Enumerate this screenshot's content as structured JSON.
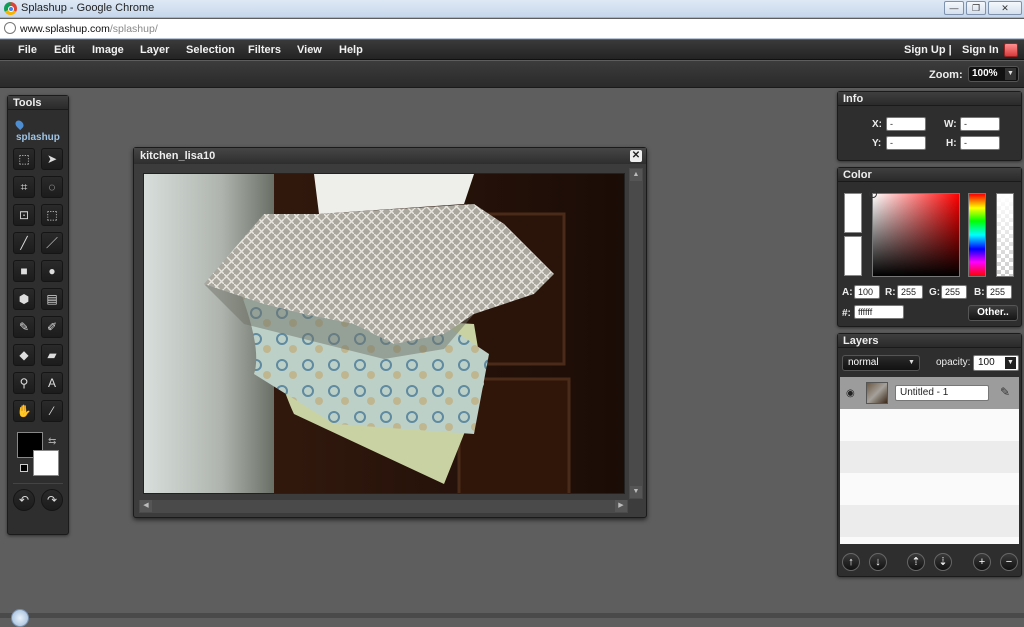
{
  "browser": {
    "window_title": "Splashup - Google Chrome",
    "url_host": "www.splashup.com",
    "url_path": "/splashup/",
    "min_label": "—",
    "max_label": "❐",
    "close_label": "✕"
  },
  "menu": {
    "items": [
      "File",
      "Edit",
      "Image",
      "Layer",
      "Selection",
      "Filters",
      "View",
      "Help"
    ],
    "sign_up": "Sign Up |",
    "sign_in": "Sign In"
  },
  "toolbar": {
    "zoom_label": "Zoom:",
    "zoom_value": "100%"
  },
  "tools_panel": {
    "title": "Tools",
    "logo_text": "splashup",
    "tool_icons": [
      "marquee-rect-icon",
      "move-arrow-icon",
      "crop-icon",
      "lasso-icon",
      "transform-icon",
      "magic-select-icon",
      "pencil-icon",
      "line-icon",
      "rectangle-icon",
      "ellipse-icon",
      "polygon-icon",
      "gradient-icon",
      "brush-icon",
      "airbrush-icon",
      "fill-bucket-icon",
      "eraser-icon",
      "clone-stamp-icon",
      "text-icon",
      "hand-icon",
      "eyedropper-icon"
    ],
    "foreground_color": "#000000",
    "background_color": "#ffffff"
  },
  "document": {
    "title": "kitchen_lisa10",
    "close_label": "✕"
  },
  "info_panel": {
    "title": "Info",
    "x_label": "X:",
    "y_label": "Y:",
    "w_label": "W:",
    "h_label": "H:",
    "x_value": "-",
    "y_value": "-",
    "w_value": "-",
    "h_value": "-"
  },
  "color_panel": {
    "title": "Color",
    "a_label": "A:",
    "r_label": "R:",
    "g_label": "G:",
    "b_label": "B:",
    "hex_label": "#:",
    "a_value": "100",
    "r_value": "255",
    "g_value": "255",
    "b_value": "255",
    "hex_value": "ffffff",
    "other_button": "Other.."
  },
  "layers_panel": {
    "title": "Layers",
    "blend_mode": "normal",
    "opacity_label": "opacity:",
    "opacity_value": "100",
    "layers": [
      {
        "name": "Untitled - 1"
      }
    ]
  }
}
